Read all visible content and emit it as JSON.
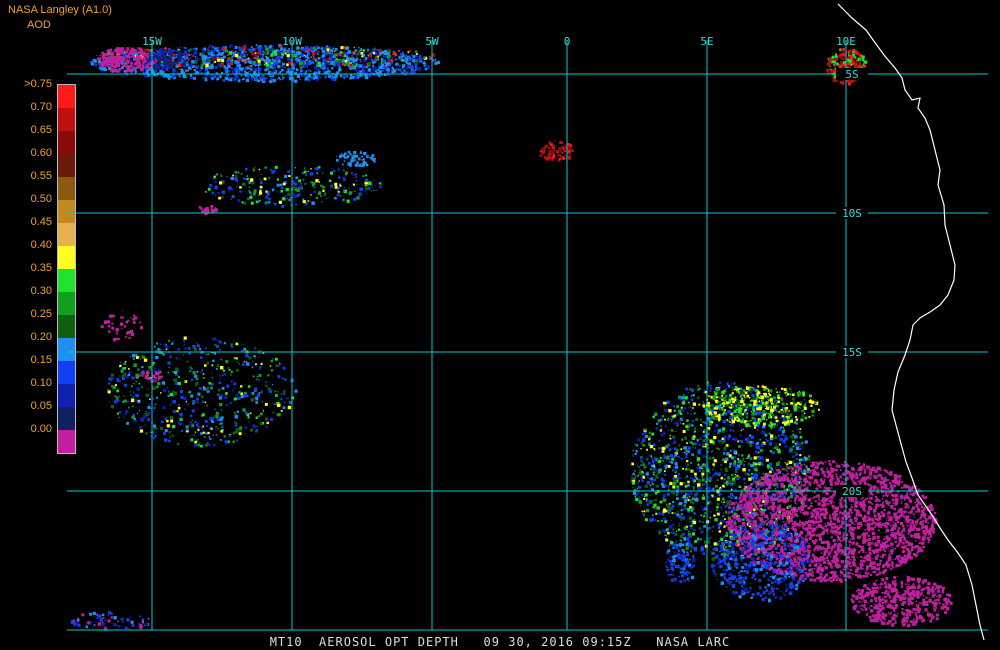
{
  "header": {
    "source": "NASA Langley (A1.0)",
    "param": "AOD"
  },
  "legend": {
    "labels": [
      ">0.75",
      "0.70",
      "0.65",
      "0.60",
      "0.55",
      "0.50",
      "0.45",
      "0.40",
      "0.35",
      "0.30",
      "0.25",
      "0.20",
      "0.15",
      "0.10",
      "0.05",
      "0.00"
    ],
    "colors": [
      "#ff1a1a",
      "#c01010",
      "#8a0a0a",
      "#6a1a0a",
      "#8a5a10",
      "#c08a20",
      "#e8b050",
      "#ffff20",
      "#20e030",
      "#10a020",
      "#106010",
      "#2090f0",
      "#1040f0",
      "#1020b0",
      "#102060",
      "#c020a0"
    ]
  },
  "map": {
    "lon_labels": [
      "15W",
      "10W",
      "5W",
      "0",
      "5E",
      "10E"
    ],
    "lat_labels": [
      "5S",
      "10S",
      "15S",
      "20S"
    ],
    "grid_color": "#00cccc",
    "coast_color": "#ffffff"
  },
  "footer": {
    "text": "MT10  AEROSOL OPT DEPTH   09 30, 2016 09:15Z   NASA LARC"
  },
  "chart_data": {
    "type": "heatmap",
    "title": "MT10  AEROSOL OPT DEPTH   09 30, 2016 09:15Z   NASA LARC",
    "colorbar_label": "AOD",
    "colorbar_range": [
      0.0,
      0.75
    ],
    "lon_ticks": [
      "15W",
      "10W",
      "5W",
      "0",
      "5E",
      "10E"
    ],
    "lat_ticks": [
      "5S",
      "10S",
      "15S",
      "20S"
    ]
  }
}
